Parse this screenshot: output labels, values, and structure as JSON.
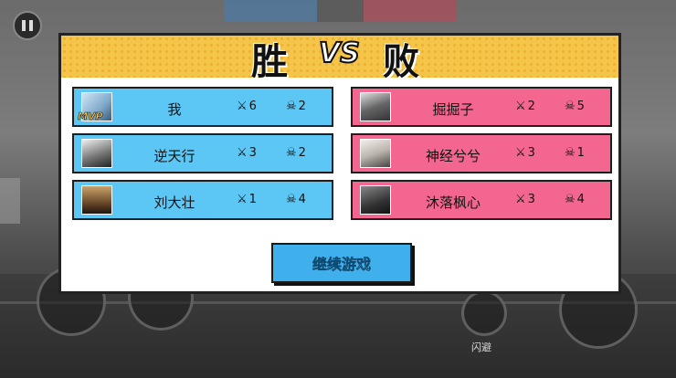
{
  "header": {
    "win_label": "胜",
    "vs_label": "VS",
    "lose_label": "败"
  },
  "icons": {
    "kills": "crossed-swords-icon",
    "deaths": "skull-icon"
  },
  "winning_team": [
    {
      "name": "我",
      "kills": "6",
      "deaths": "2",
      "badge": "MVP"
    },
    {
      "name": "逆天行",
      "kills": "3",
      "deaths": "2"
    },
    {
      "name": "刘大壮",
      "kills": "1",
      "deaths": "4"
    }
  ],
  "losing_team": [
    {
      "name": "掘掘子",
      "kills": "2",
      "deaths": "5"
    },
    {
      "name": "神经兮兮",
      "kills": "3",
      "deaths": "1"
    },
    {
      "name": "沐落枫心",
      "kills": "3",
      "deaths": "4"
    }
  ],
  "continue_button": "继续游戏",
  "background": {
    "dodge_label": "闪避"
  },
  "colors": {
    "win_row": "#5cc6f4",
    "lose_row": "#f3668f",
    "header": "#f5c54a",
    "button": "#3fb0ec"
  }
}
